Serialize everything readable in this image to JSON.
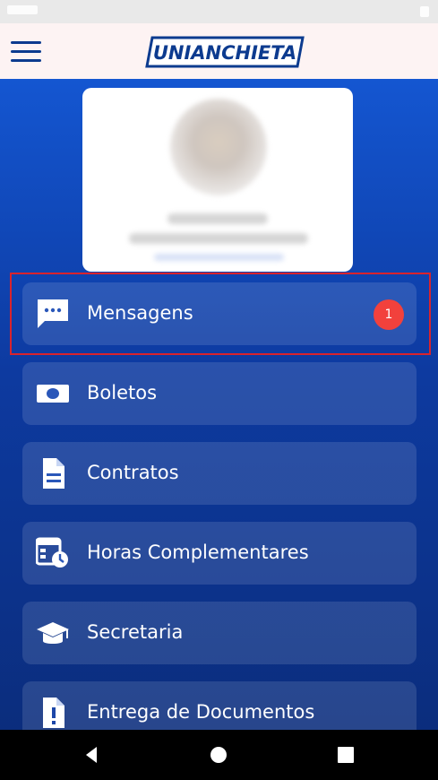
{
  "app": {
    "logo_text": "UNIANCHIETA"
  },
  "menu": {
    "items": [
      {
        "label": "Mensagens",
        "icon": "message-dots-icon",
        "badge": "1"
      },
      {
        "label": "Boletos",
        "icon": "money-bill-icon"
      },
      {
        "label": "Contratos",
        "icon": "document-icon"
      },
      {
        "label": "Horas Complementares",
        "icon": "calendar-clock-icon"
      },
      {
        "label": "Secretaria",
        "icon": "graduation-cap-icon"
      },
      {
        "label": "Entrega de Documentos",
        "icon": "document-alert-icon"
      }
    ]
  },
  "colors": {
    "accent": "#1456d1",
    "appbar": "#fdf3f3",
    "badge": "#f2413c",
    "highlight": "#d9232d"
  }
}
